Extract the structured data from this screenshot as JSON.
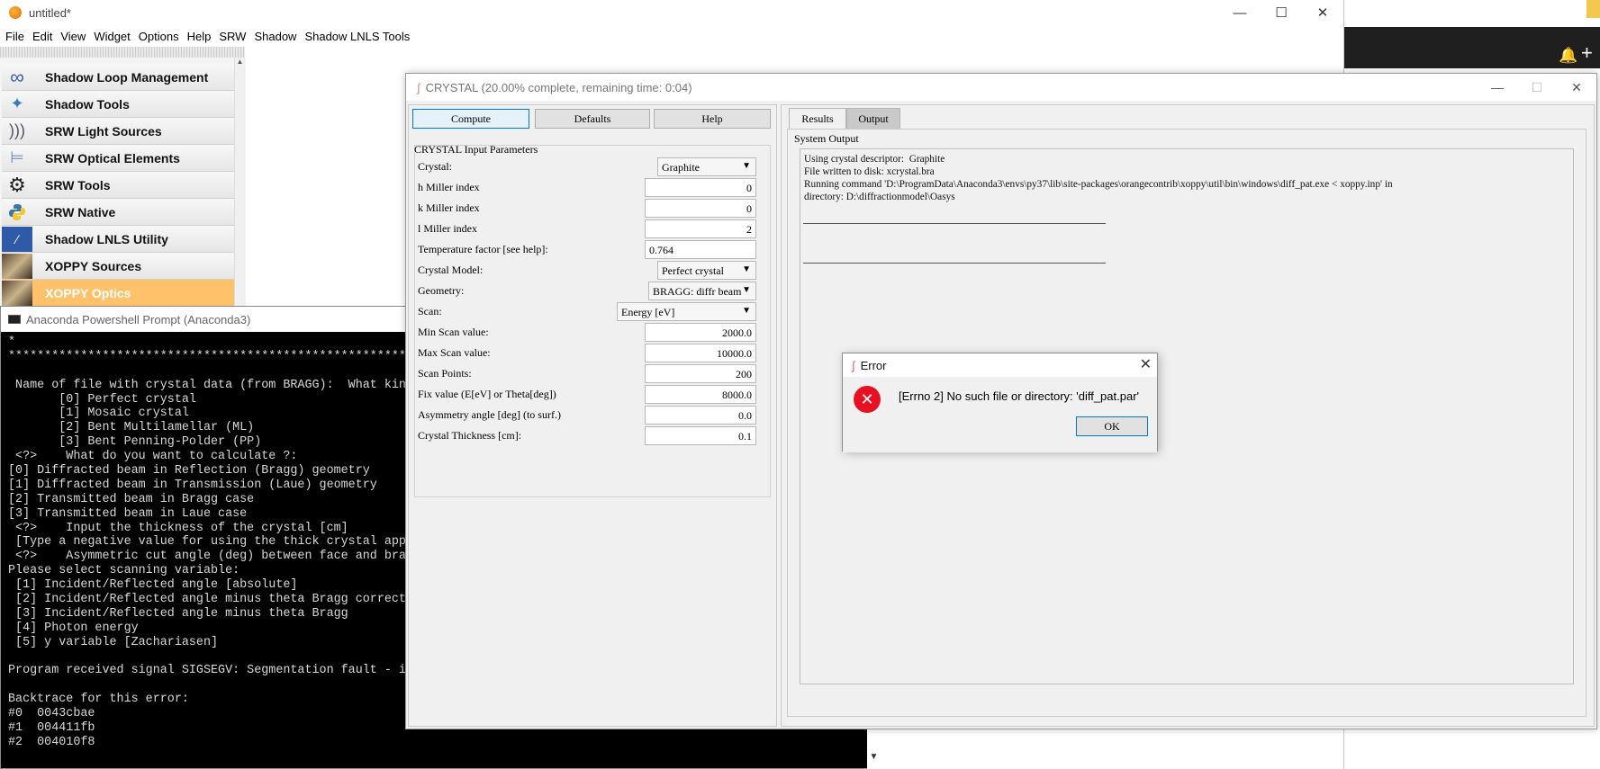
{
  "orange": {
    "title": "untitled*",
    "menu": [
      "File",
      "Edit",
      "View",
      "Widget",
      "Options",
      "Help",
      "SRW",
      "Shadow",
      "Shadow LNLS Tools"
    ],
    "toolbox": [
      {
        "label": "Shadow Loop Management",
        "icon": "infinity-icon"
      },
      {
        "label": "Shadow Tools",
        "icon": "tools-icon"
      },
      {
        "label": "SRW Light Sources",
        "icon": "wave-icon"
      },
      {
        "label": "SRW Optical Elements",
        "icon": "optical-element-icon"
      },
      {
        "label": "SRW Tools",
        "icon": "gear-icon"
      },
      {
        "label": "SRW Native",
        "icon": "python-icon"
      },
      {
        "label": "Shadow LNLS Utility",
        "icon": "utility-icon"
      },
      {
        "label": "XOPPY Sources",
        "icon": "xoppy-sources-icon"
      },
      {
        "label": "XOPPY Optics",
        "icon": "xoppy-optics-icon"
      }
    ]
  },
  "powershell": {
    "title": "Anaconda Powershell Prompt (Anaconda3)",
    "lines": [
      "*                                                      *",
      "********************************************************",
      "",
      " Name of file with crystal data (from BRAGG):  What kin",
      "       [0] Perfect crystal",
      "       [1] Mosaic crystal",
      "       [2] Bent Multilamellar (ML)",
      "       [3] Bent Penning-Polder (PP)",
      " <?>    What do you want to calculate ?:",
      "[0] Diffracted beam in Reflection (Bragg) geometry",
      "[1] Diffracted beam in Transmission (Laue) geometry",
      "[2] Transmitted beam in Bragg case",
      "[3] Transmitted beam in Laue case",
      " <?>    Input the thickness of the crystal [cm]",
      " [Type a negative value for using the thick crystal app",
      " <?>    Asymmetric cut angle (deg) between face and bra",
      "Please select scanning variable:",
      " [1] Incident/Reflected angle [absolute]",
      " [2] Incident/Reflected angle minus theta Bragg correct",
      " [3] Incident/Reflected angle minus theta Bragg",
      " [4] Photon energy",
      " [5] y variable [Zachariasen]",
      "",
      "Program received signal SIGSEGV: Segmentation fault - in",
      "",
      "Backtrace for this error:",
      "#0  0043cbae",
      "#1  004411fb",
      "#2  004010f8"
    ]
  },
  "crystal": {
    "title": "CRYSTAL (20.00% complete, remaining time: 0:04)",
    "buttons": {
      "compute": "Compute",
      "defaults": "Defaults",
      "help": "Help"
    },
    "params_title": "CRYSTAL Input Parameters",
    "params": [
      {
        "label": "Crystal:",
        "value": "Graphite",
        "kind": "combo"
      },
      {
        "label": "h Miller index",
        "value": "0",
        "kind": "input"
      },
      {
        "label": "k Miller index",
        "value": "0",
        "kind": "input"
      },
      {
        "label": "l Miller index",
        "value": "2",
        "kind": "input"
      },
      {
        "label": "Temperature factor [see help]:",
        "value": "0.764",
        "kind": "input-left"
      },
      {
        "label": "Crystal Model:",
        "value": "Perfect crystal",
        "kind": "combo"
      },
      {
        "label": "Geometry:",
        "value": "BRAGG: diffr beam",
        "kind": "combo-wide"
      },
      {
        "label": "Scan:",
        "value": "Energy [eV]",
        "kind": "combo-xwide"
      },
      {
        "label": "Min Scan value:",
        "value": "2000.0",
        "kind": "input"
      },
      {
        "label": "Max Scan value:",
        "value": "10000.0",
        "kind": "input"
      },
      {
        "label": "Scan Points:",
        "value": "200",
        "kind": "input"
      },
      {
        "label": "Fix value (E[eV] or Theta[deg])",
        "value": "8000.0",
        "kind": "input"
      },
      {
        "label": "Asymmetry angle [deg] (to surf.)",
        "value": "0.0",
        "kind": "input"
      },
      {
        "label": "Crystal Thickness [cm]:",
        "value": "0.1",
        "kind": "input"
      }
    ],
    "tabs": {
      "results": "Results",
      "output": "Output"
    },
    "system_output_label": "System Output",
    "output_lines": [
      "Using crystal descriptor:  Graphite",
      "File written to disk: xcrystal.bra",
      "Running command 'D:\\ProgramData\\Anaconda3\\envs\\py37\\lib\\site-packages\\orangecontrib\\xoppy\\util\\bin\\windows\\diff_pat.exe < xoppy.inp' in",
      "directory: D:\\diffractionmodel\\Oasys"
    ]
  },
  "error_dialog": {
    "title": "Error",
    "message": "[Errno 2] No such file or directory: 'diff_pat.par'",
    "ok": "OK"
  }
}
